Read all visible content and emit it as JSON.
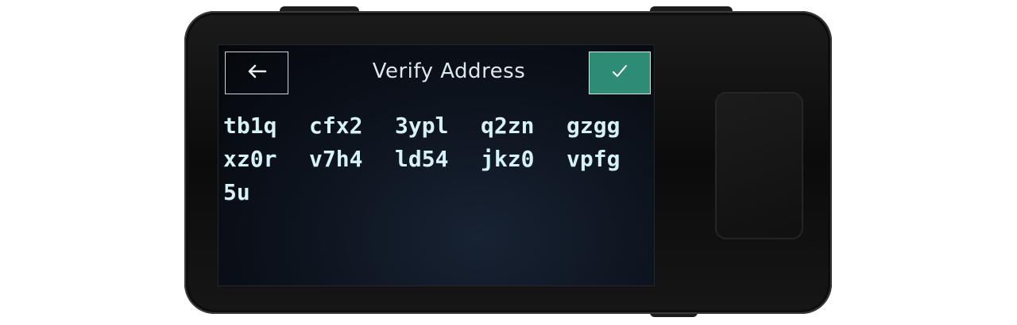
{
  "screen": {
    "title": "Verify Address",
    "back_button": {
      "icon": "arrow-left-icon"
    },
    "confirm_button": {
      "icon": "checkmark-icon",
      "color": "#2e8c76"
    }
  },
  "address": {
    "chunks": [
      "tb1q",
      "cfx2",
      "3ypl",
      "q2zn",
      "gzgg",
      "xz0r",
      "v7h4",
      "ld54",
      "jkz0",
      "vpfg",
      "5u"
    ]
  },
  "colors": {
    "text": "#d6f2f6",
    "screen_background": "#0c121b",
    "accent": "#2e8c76"
  }
}
